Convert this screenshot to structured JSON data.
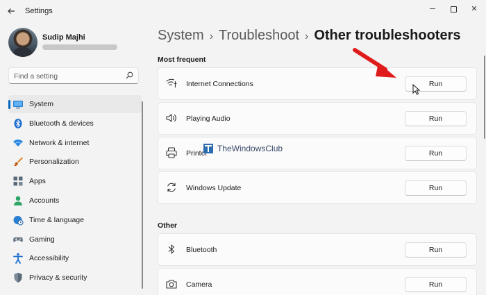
{
  "window": {
    "title": "Settings",
    "back_icon": "back-arrow-icon",
    "minimize_glyph": "─",
    "close_glyph": "✕"
  },
  "profile": {
    "name": "Sudip Majhi"
  },
  "search": {
    "placeholder": "Find a setting",
    "icon": "search-icon"
  },
  "sidebar": {
    "items": [
      {
        "label": "System",
        "icon": "system-icon",
        "active": true
      },
      {
        "label": "Bluetooth & devices",
        "icon": "bluetooth-icon"
      },
      {
        "label": "Network & internet",
        "icon": "wifi-icon"
      },
      {
        "label": "Personalization",
        "icon": "brush-icon"
      },
      {
        "label": "Apps",
        "icon": "apps-icon"
      },
      {
        "label": "Accounts",
        "icon": "accounts-icon"
      },
      {
        "label": "Time & language",
        "icon": "globe-clock-icon"
      },
      {
        "label": "Gaming",
        "icon": "gamepad-icon"
      },
      {
        "label": "Accessibility",
        "icon": "accessibility-icon"
      },
      {
        "label": "Privacy & security",
        "icon": "shield-icon"
      }
    ]
  },
  "breadcrumb": {
    "items": [
      "System",
      "Troubleshoot"
    ],
    "separator": "›",
    "current": "Other troubleshooters"
  },
  "sections": {
    "most_frequent": {
      "title": "Most frequent",
      "items": [
        {
          "label": "Internet Connections",
          "icon": "network-icon",
          "button": "Run"
        },
        {
          "label": "Playing Audio",
          "icon": "speaker-icon",
          "button": "Run"
        },
        {
          "label": "Printer",
          "icon": "printer-icon",
          "button": "Run"
        },
        {
          "label": "Windows Update",
          "icon": "refresh-icon",
          "button": "Run"
        }
      ]
    },
    "other": {
      "title": "Other",
      "items": [
        {
          "label": "Bluetooth",
          "icon": "bluetooth-icon",
          "button": "Run"
        },
        {
          "label": "Camera",
          "icon": "camera-icon",
          "button": "Run"
        }
      ]
    }
  },
  "watermark": {
    "text": "TheWindowsClub"
  },
  "colors": {
    "accent": "#0067c0",
    "annotation_arrow": "#e01b1b",
    "background": "#f3f3f3",
    "card": "#fbfbfb"
  }
}
